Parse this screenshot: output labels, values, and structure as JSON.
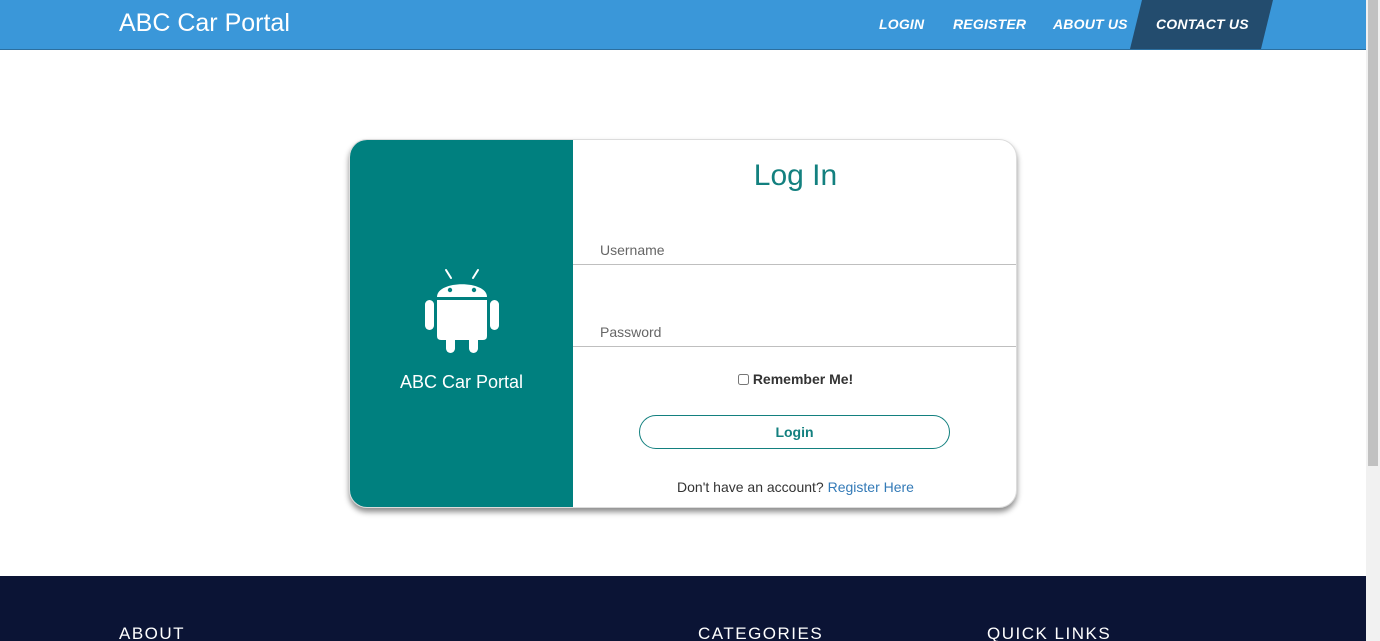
{
  "navbar": {
    "brand": "ABC Car Portal",
    "items": [
      "LOGIN",
      "REGISTER",
      "ABOUT US",
      "CONTACT US"
    ],
    "active_item": "CONTACT US"
  },
  "card": {
    "logo_icon": "android-icon",
    "left_title": "ABC Car Portal",
    "title": "Log In",
    "username_placeholder": "Username",
    "password_placeholder": "Password",
    "remember_label": "Remember Me!",
    "login_button": "Login",
    "signup_prompt": "Don't have an account?",
    "signup_link": "Register Here"
  },
  "footer": {
    "headings": [
      "ABOUT",
      "CATEGORIES",
      "QUICK LINKS"
    ]
  },
  "colors": {
    "navbar": "#3a97d9",
    "nav_active": "#234c6e",
    "teal": "#00807f",
    "footer": "#0b1435",
    "link": "#337ab7"
  }
}
